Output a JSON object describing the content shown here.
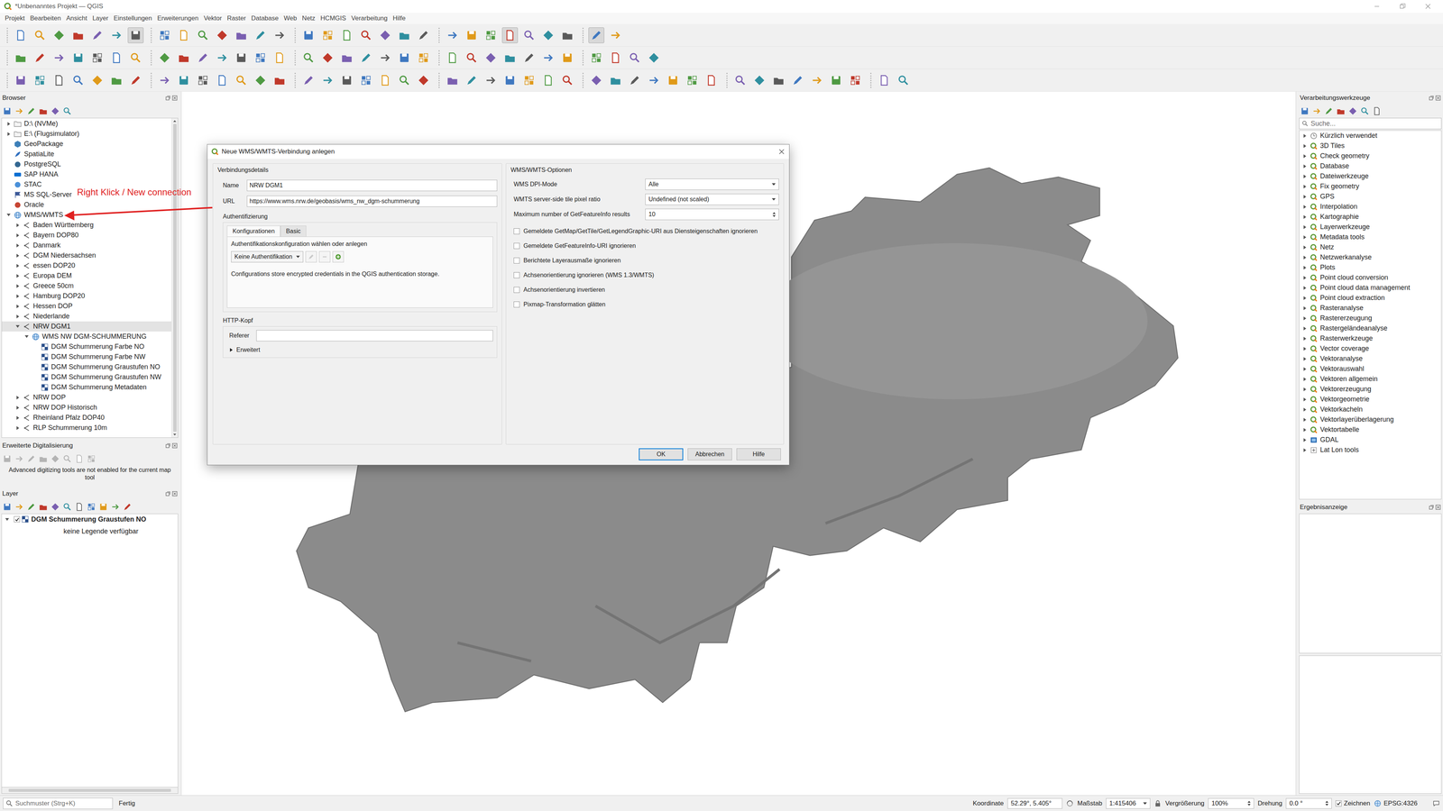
{
  "window": {
    "title": "*Unbenanntes Projekt — QGIS"
  },
  "menu": [
    "Projekt",
    "Bearbeiten",
    "Ansicht",
    "Layer",
    "Einstellungen",
    "Erweiterungen",
    "Vektor",
    "Raster",
    "Database",
    "Web",
    "Netz",
    "HCMGIS",
    "Verarbeitung",
    "Hilfe"
  ],
  "toolbars": [
    [
      false,
      false,
      false,
      false,
      false,
      false,
      true,
      false,
      false,
      false,
      false,
      false,
      false,
      false,
      false,
      false,
      false,
      false,
      false,
      false,
      false,
      false,
      false,
      false,
      true,
      false,
      false,
      false,
      true,
      false
    ],
    [
      false,
      false,
      false,
      false,
      false,
      false,
      false,
      false,
      false,
      false,
      false,
      false,
      false,
      false,
      false,
      false,
      false,
      false,
      false,
      false,
      false,
      false,
      false,
      false,
      false,
      false,
      false,
      false,
      false,
      false,
      false,
      false
    ],
    [
      false,
      false,
      false,
      false,
      false,
      false,
      false,
      false,
      false,
      false,
      false,
      false,
      false,
      false,
      false,
      false,
      false,
      false,
      false,
      false,
      false,
      false,
      false,
      false,
      false,
      false,
      false,
      false,
      false,
      false,
      false,
      false,
      false,
      false,
      false,
      false,
      false,
      false,
      false,
      false,
      false,
      false,
      false,
      false
    ]
  ],
  "browser": {
    "title": "Browser",
    "items": [
      {
        "label": "D:\\ (NVMe)",
        "level": 0,
        "kind": "drive",
        "expandable": true,
        "expanded": false,
        "selected": false
      },
      {
        "label": "E:\\ (Flugsimulator)",
        "level": 0,
        "kind": "drive",
        "expandable": true,
        "expanded": false,
        "selected": false
      },
      {
        "label": "GeoPackage",
        "level": 0,
        "kind": "geopackage",
        "expandable": false,
        "expanded": false,
        "selected": false
      },
      {
        "label": "SpatiaLite",
        "level": 0,
        "kind": "spatialite",
        "expandable": false,
        "expanded": false,
        "selected": false
      },
      {
        "label": "PostgreSQL",
        "level": 0,
        "kind": "postgresql",
        "expandable": false,
        "expanded": false,
        "selected": false
      },
      {
        "label": "SAP HANA",
        "level": 0,
        "kind": "saphana",
        "expandable": false,
        "expanded": false,
        "selected": false
      },
      {
        "label": "STAC",
        "level": 0,
        "kind": "stac",
        "expandable": false,
        "expanded": false,
        "selected": false
      },
      {
        "label": "MS SQL-Server",
        "level": 0,
        "kind": "mssql",
        "expandable": false,
        "expanded": false,
        "selected": false
      },
      {
        "label": "Oracle",
        "level": 0,
        "kind": "oracle",
        "expandable": false,
        "expanded": false,
        "selected": false
      },
      {
        "label": "WMS/WMTS",
        "level": 0,
        "kind": "wms",
        "expandable": true,
        "expanded": true,
        "selected": false
      },
      {
        "label": "Baden Württemberg",
        "level": 1,
        "kind": "connection",
        "expandable": true,
        "expanded": false,
        "selected": false
      },
      {
        "label": "Bayern DOP80",
        "level": 1,
        "kind": "connection",
        "expandable": true,
        "expanded": false,
        "selected": false
      },
      {
        "label": "Danmark",
        "level": 1,
        "kind": "connection",
        "expandable": true,
        "expanded": false,
        "selected": false
      },
      {
        "label": "DGM Niedersachsen",
        "level": 1,
        "kind": "connection",
        "expandable": true,
        "expanded": false,
        "selected": false
      },
      {
        "label": "essen DOP20",
        "level": 1,
        "kind": "connection",
        "expandable": true,
        "expanded": false,
        "selected": false
      },
      {
        "label": "Europa DEM",
        "level": 1,
        "kind": "connection",
        "expandable": true,
        "expanded": false,
        "selected": false
      },
      {
        "label": "Greece 50cm",
        "level": 1,
        "kind": "connection",
        "expandable": true,
        "expanded": false,
        "selected": false
      },
      {
        "label": "Hamburg DOP20",
        "level": 1,
        "kind": "connection",
        "expandable": true,
        "expanded": false,
        "selected": false
      },
      {
        "label": "Hessen DOP",
        "level": 1,
        "kind": "connection",
        "expandable": true,
        "expanded": false,
        "selected": false
      },
      {
        "label": "Niederlande",
        "level": 1,
        "kind": "connection",
        "expandable": true,
        "expanded": false,
        "selected": false
      },
      {
        "label": "NRW DGM1",
        "level": 1,
        "kind": "connection",
        "expandable": true,
        "expanded": true,
        "selected": true
      },
      {
        "label": "WMS NW DGM-SCHUMMERUNG",
        "level": 2,
        "kind": "service",
        "expandable": true,
        "expanded": true,
        "selected": false
      },
      {
        "label": "DGM Schummerung Farbe NO",
        "level": 3,
        "kind": "layer",
        "expandable": false,
        "expanded": false,
        "selected": false
      },
      {
        "label": "DGM Schummerung Farbe NW",
        "level": 3,
        "kind": "layer",
        "expandable": false,
        "expanded": false,
        "selected": false
      },
      {
        "label": "DGM Schummerung Graustufen NO",
        "level": 3,
        "kind": "layer",
        "expandable": false,
        "expanded": false,
        "selected": false
      },
      {
        "label": "DGM Schummerung Graustufen NW",
        "level": 3,
        "kind": "layer",
        "expandable": false,
        "expanded": false,
        "selected": false
      },
      {
        "label": "DGM Schummerung Metadaten",
        "level": 3,
        "kind": "layer",
        "expandable": false,
        "expanded": false,
        "selected": false
      },
      {
        "label": "NRW DOP",
        "level": 1,
        "kind": "connection",
        "expandable": true,
        "expanded": false,
        "selected": false
      },
      {
        "label": "NRW DOP Historisch",
        "level": 1,
        "kind": "connection",
        "expandable": true,
        "expanded": false,
        "selected": false
      },
      {
        "label": "Rheinland Pfalz DOP40",
        "level": 1,
        "kind": "connection",
        "expandable": true,
        "expanded": false,
        "selected": false
      },
      {
        "label": "RLP Schummerung 10m",
        "level": 1,
        "kind": "connection",
        "expandable": true,
        "expanded": false,
        "selected": false
      }
    ]
  },
  "annotation": {
    "text": "Right Klick / New connection"
  },
  "digitizing": {
    "title": "Erweiterte Digitalisierung",
    "message": "Advanced digitizing tools are not enabled for the current map tool"
  },
  "layers": {
    "title": "Layer",
    "items": [
      {
        "label": "DGM Schummerung Graustufen NO",
        "checked": true,
        "expanded": true,
        "legend": "keine Legende verfügbar"
      }
    ]
  },
  "processing": {
    "title": "Verarbeitungswerkzeuge",
    "search_placeholder": "Suche...",
    "items": [
      {
        "label": "Kürzlich verwendet",
        "kind": "recent",
        "expanded": false
      },
      {
        "label": "3D Tiles",
        "kind": "qgis",
        "expanded": false
      },
      {
        "label": "Check geometry",
        "kind": "qgis",
        "expanded": false
      },
      {
        "label": "Database",
        "kind": "qgis",
        "expanded": false
      },
      {
        "label": "Dateiwerkzeuge",
        "kind": "qgis",
        "expanded": false
      },
      {
        "label": "Fix geometry",
        "kind": "qgis",
        "expanded": false
      },
      {
        "label": "GPS",
        "kind": "qgis",
        "expanded": false
      },
      {
        "label": "Interpolation",
        "kind": "qgis",
        "expanded": false
      },
      {
        "label": "Kartographie",
        "kind": "qgis",
        "expanded": false
      },
      {
        "label": "Layerwerkzeuge",
        "kind": "qgis",
        "expanded": false
      },
      {
        "label": "Metadata tools",
        "kind": "qgis",
        "expanded": false
      },
      {
        "label": "Netz",
        "kind": "qgis",
        "expanded": false
      },
      {
        "label": "Netzwerkanalyse",
        "kind": "qgis",
        "expanded": false
      },
      {
        "label": "Plots",
        "kind": "qgis",
        "expanded": false
      },
      {
        "label": "Point cloud conversion",
        "kind": "qgis",
        "expanded": false
      },
      {
        "label": "Point cloud data management",
        "kind": "qgis",
        "expanded": false
      },
      {
        "label": "Point cloud extraction",
        "kind": "qgis",
        "expanded": false
      },
      {
        "label": "Rasteranalyse",
        "kind": "qgis",
        "expanded": false
      },
      {
        "label": "Rastererzeugung",
        "kind": "qgis",
        "expanded": false
      },
      {
        "label": "Rastergeländeanalyse",
        "kind": "qgis",
        "expanded": false
      },
      {
        "label": "Rasterwerkzeuge",
        "kind": "qgis",
        "expanded": false
      },
      {
        "label": "Vector coverage",
        "kind": "qgis",
        "expanded": false
      },
      {
        "label": "Vektoranalyse",
        "kind": "qgis",
        "expanded": false
      },
      {
        "label": "Vektorauswahl",
        "kind": "qgis",
        "expanded": false
      },
      {
        "label": "Vektoren allgemein",
        "kind": "qgis",
        "expanded": false
      },
      {
        "label": "Vektorerzeugung",
        "kind": "qgis",
        "expanded": false
      },
      {
        "label": "Vektorgeometrie",
        "kind": "qgis",
        "expanded": false
      },
      {
        "label": "Vektorkacheln",
        "kind": "qgis",
        "expanded": false
      },
      {
        "label": "Vektorlayerüberlagerung",
        "kind": "qgis",
        "expanded": false
      },
      {
        "label": "Vektortabelle",
        "kind": "qgis",
        "expanded": false
      },
      {
        "label": "GDAL",
        "kind": "gdal",
        "expanded": false
      },
      {
        "label": "Lat Lon tools",
        "kind": "plugin",
        "expanded": false
      }
    ]
  },
  "results": {
    "title": "Ergebnisanzeige"
  },
  "dialog": {
    "title": "Neue WMS/WMTS-Verbindung anlegen",
    "details": {
      "title": "Verbindungsdetails",
      "fields": [
        {
          "label": "Name",
          "value": "NRW DGM1"
        },
        {
          "label": "URL",
          "value": "https://www.wms.nrw.de/geobasis/wms_nw_dgm-schummerung"
        }
      ]
    },
    "auth": {
      "title": "Authentifizierung",
      "tabs": [
        {
          "label": "Konfigurationen",
          "selected": true
        },
        {
          "label": "Basic",
          "selected": false
        }
      ],
      "prompt": "Authentifikationskonfiguration wählen oder anlegen",
      "combo": "Keine Authentifikation",
      "note": "Configurations store encrypted credentials in the QGIS authentication storage."
    },
    "http": {
      "title": "HTTP-Kopf",
      "referer_label": "Referer",
      "referer_value": "",
      "advanced": {
        "label": "Erweitert",
        "expanded": false
      }
    },
    "options": {
      "title": "WMS/WMTS-Optionen",
      "fields": [
        {
          "label": "WMS DPI-Mode",
          "value": "Alle",
          "kind": "combo"
        },
        {
          "label": "WMTS server-side tile pixel ratio",
          "value": "Undefined (not scaled)",
          "kind": "combo"
        },
        {
          "label": "Maximum number of GetFeatureInfo results",
          "value": "10",
          "kind": "spin"
        }
      ],
      "checks": [
        {
          "label": "Gemeldete GetMap/GetTile/GetLegendGraphic-URI aus Diensteigenschaften ignorieren",
          "checked": false
        },
        {
          "label": "Gemeldete GetFeatureInfo-URI ignorieren",
          "checked": false
        },
        {
          "label": "Berichtete Layerausmaße ignorieren",
          "checked": false
        },
        {
          "label": "Achsenorientierung ignorieren (WMS 1.3/WMTS)",
          "checked": false
        },
        {
          "label": "Achsenorientierung invertieren",
          "checked": false
        },
        {
          "label": "Pixmap-Transformation glätten",
          "checked": false
        }
      ]
    },
    "buttons": [
      {
        "label": "OK",
        "default": true
      },
      {
        "label": "Abbrechen",
        "default": false
      },
      {
        "label": "Hilfe",
        "default": false
      }
    ]
  },
  "status_bar": {
    "search_placeholder": "Suchmuster (Strg+K)",
    "message": "Fertig",
    "coordinate_label": "Koordinate",
    "coordinate": "52.29°, 5.405°",
    "scale_label": "Maßstab",
    "scale": "1:415406",
    "magnifier_label": "Vergrößerung",
    "magnifier": "100%",
    "rotation_label": "Drehung",
    "rotation": "0.0 °",
    "render": {
      "label": "Zeichnen",
      "checked": true
    },
    "crs": "EPSG:4326"
  }
}
